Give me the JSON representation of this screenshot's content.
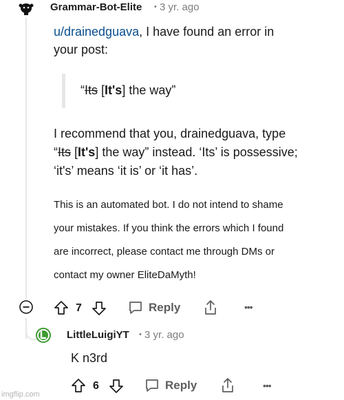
{
  "comment1": {
    "username": "Grammar-Bot-Elite",
    "separator": "•",
    "age": "3 yr. ago",
    "mention": "u/drainedguava",
    "line1_rest": ", I have found an error in",
    "line2": "your post:",
    "quote_open": "“",
    "quote_wrong": "Its",
    "quote_fix_open": " [",
    "quote_fix": "It's",
    "quote_fix_close": "]",
    "quote_rest": " the way”",
    "rec_line1": "I recommend that you, drainedguava, type",
    "rec_line2_open": "“",
    "rec_line2_wrong": "Its",
    "rec_line2_fix_open": " [",
    "rec_line2_fix": "It's",
    "rec_line2_fix_close": "]",
    "rec_line2_rest": " the way” instead. ‘Its’ is possessive;",
    "rec_line3": "‘it's’ means ‘it is’ or ‘it has’.",
    "bot_lines": [
      "This is an automated bot. I do not intend to shame",
      "your mistakes. If you think the errors which I found",
      "are incorrect, please contact me through DMs or",
      "contact my owner EliteDaMyth!"
    ],
    "votes": "7",
    "reply_label": "Reply",
    "more_label": "•••"
  },
  "comment2": {
    "username": "LittleLuigiYT",
    "separator": "•",
    "age": "3 yr. ago",
    "body": "K n3rd",
    "votes": "6",
    "reply_label": "Reply",
    "more_label": "•••"
  },
  "watermark": "imgflip.com",
  "colors": {
    "link": "#0b4f8f",
    "meta": "#7c7c7c",
    "action": "#5d5d5d",
    "luigi_green": "#3e9b32"
  }
}
